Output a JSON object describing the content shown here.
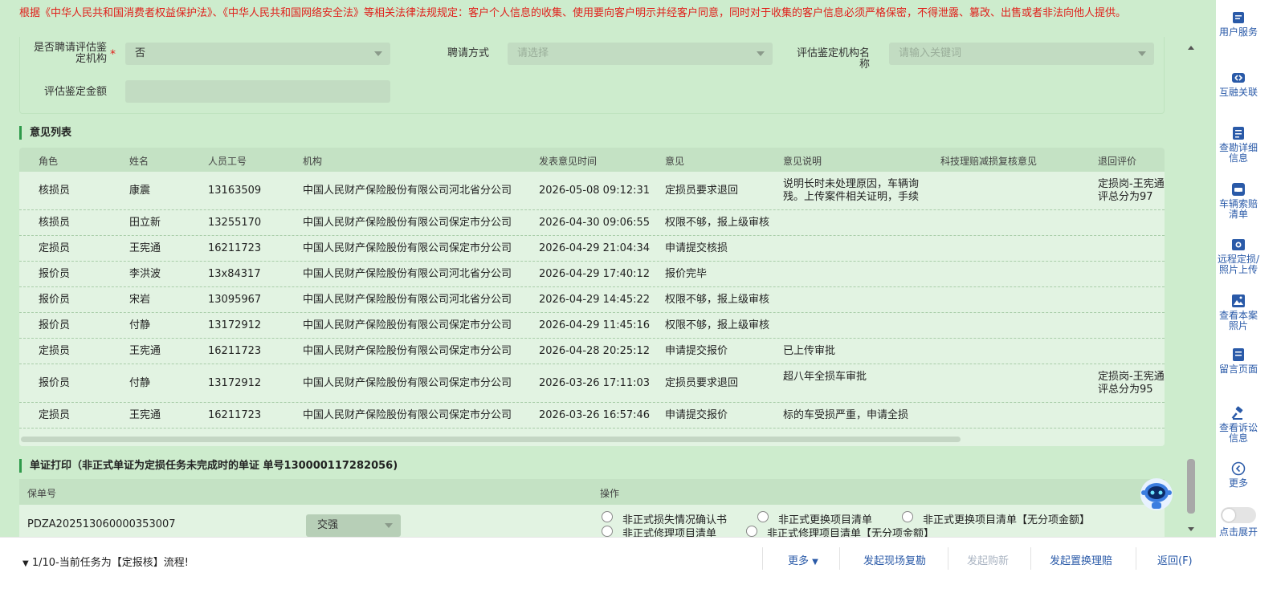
{
  "notice": "根据《中华人民共和国消费者权益保护法》、《中华人民共和国网络安全法》等相关法律法规规定：客户个人信息的收集、使用要向客户明示并经客户同意，同时对于收集的客户信息必须严格保密，不得泄露、篡改、出售或者非法向他人提供。",
  "form": {
    "appraisal_label": "是否聘请评估鉴定机构",
    "appraisal_value": "否",
    "hire_method_label": "聘请方式",
    "hire_method_placeholder": "请选择",
    "org_name_label": "评估鉴定机构名称",
    "org_name_placeholder": "请输入关键词",
    "amount_label": "评估鉴定金额",
    "amount_value": ""
  },
  "opinions": {
    "title": "意见列表",
    "headers": [
      "角色",
      "姓名",
      "人员工号",
      "机构",
      "发表意见时间",
      "意见",
      "意见说明",
      "科技理赔减损复核意见",
      "退回评价"
    ],
    "rows": [
      {
        "role": "核损员",
        "name": "康震",
        "id": "13163509",
        "org": "中国人民财产保险股份有限公司河北省分公司",
        "time": "2026-05-08 09:12:31",
        "opinion": "定损员要求退回",
        "desc": "说明长时未处理原因，车辆询残。上传案件相关证明，手续",
        "review": "",
        "eval": "定损岗-王宪通评总分为97"
      },
      {
        "role": "核损员",
        "name": "田立新",
        "id": "13255170",
        "org": "中国人民财产保险股份有限公司保定市分公司",
        "time": "2026-04-30 09:06:55",
        "opinion": "权限不够，报上级审核",
        "desc": "",
        "review": "",
        "eval": ""
      },
      {
        "role": "定损员",
        "name": "王宪通",
        "id": "16211723",
        "org": "中国人民财产保险股份有限公司保定市分公司",
        "time": "2026-04-29 21:04:34",
        "opinion": "申请提交核损",
        "desc": "",
        "review": "",
        "eval": ""
      },
      {
        "role": "报价员",
        "name": "李洪波",
        "id": "13x84317",
        "org": "中国人民财产保险股份有限公司河北省分公司",
        "time": "2026-04-29 17:40:12",
        "opinion": "报价完毕",
        "desc": "",
        "review": "",
        "eval": ""
      },
      {
        "role": "报价员",
        "name": "宋岩",
        "id": "13095967",
        "org": "中国人民财产保险股份有限公司河北省分公司",
        "time": "2026-04-29 14:45:22",
        "opinion": "权限不够，报上级审核",
        "desc": "",
        "review": "",
        "eval": ""
      },
      {
        "role": "报价员",
        "name": "付静",
        "id": "13172912",
        "org": "中国人民财产保险股份有限公司保定市分公司",
        "time": "2026-04-29 11:45:16",
        "opinion": "权限不够，报上级审核",
        "desc": "",
        "review": "",
        "eval": ""
      },
      {
        "role": "定损员",
        "name": "王宪通",
        "id": "16211723",
        "org": "中国人民财产保险股份有限公司保定市分公司",
        "time": "2026-04-28 20:25:12",
        "opinion": "申请提交报价",
        "desc": "已上传审批",
        "review": "",
        "eval": ""
      },
      {
        "role": "报价员",
        "name": "付静",
        "id": "13172912",
        "org": "中国人民财产保险股份有限公司保定市分公司",
        "time": "2026-03-26 17:11:03",
        "opinion": "定损员要求退回",
        "desc": "超八年全损车审批",
        "review": "",
        "eval": "定损岗-王宪通评总分为95"
      },
      {
        "role": "定损员",
        "name": "王宪通",
        "id": "16211723",
        "org": "中国人民财产保险股份有限公司保定市分公司",
        "time": "2026-03-26 16:57:46",
        "opinion": "申请提交报价",
        "desc": "标的车受损严重，申请全损",
        "review": "",
        "eval": ""
      }
    ]
  },
  "print": {
    "title": "单证打印（非正式单证为定损任务未完成时的单证 单号130000117282056)",
    "col_policy": "保单号",
    "col_ops": "操作",
    "policy_no": "PDZA202513060000353007",
    "policy_type": "交强",
    "options": [
      "非正式损失情况确认书",
      "非正式更换项目清单",
      "非正式更换项目清单【无分项金额】",
      "非正式修理项目清单",
      "非正式修理项目清单【无分项金额】"
    ]
  },
  "sidebar": {
    "items": [
      {
        "label": "用户服务",
        "icon": "user-service-icon"
      },
      {
        "label": "互融关联",
        "icon": "link-icon"
      },
      {
        "label": "查勘详细信息",
        "icon": "survey-icon"
      },
      {
        "label": "车辆索赔清单",
        "icon": "car-icon"
      },
      {
        "label": "远程定损/照片上传",
        "icon": "camera-upload-icon"
      },
      {
        "label": "查看本案照片",
        "icon": "photo-icon"
      },
      {
        "label": "留言页面",
        "icon": "message-icon"
      },
      {
        "label": "查看诉讼信息",
        "icon": "gavel-icon"
      },
      {
        "label": "更多",
        "icon": "chevron-left-icon"
      }
    ],
    "expand_label": "点击展开"
  },
  "footer": {
    "task_text": "1/10-当前任务为【定报核】流程!",
    "more": "更多",
    "onsite_recheck": "发起现场复勘",
    "purchase": "发起购新",
    "replacement": "发起置换理赔",
    "back": "返回(F)"
  },
  "colors": {
    "accent_green": "#2e9a4a",
    "link_blue": "#2a5aa8",
    "warning_red": "#e0201b",
    "bg_green": "#cdeccd"
  }
}
